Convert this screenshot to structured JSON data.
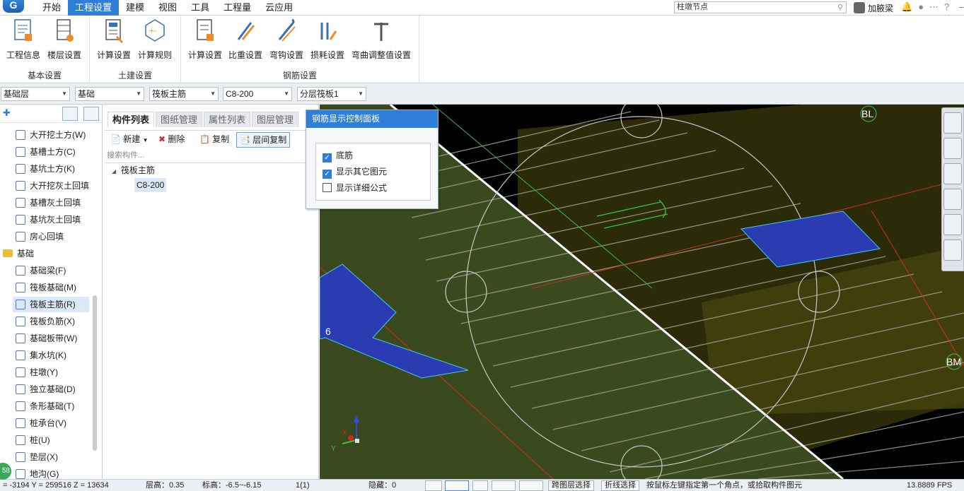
{
  "menu": {
    "tabs": [
      "开始",
      "工程设置",
      "建模",
      "视图",
      "工具",
      "工程量",
      "云应用"
    ],
    "active_tab": "工程设置",
    "search_value": "柱墩节点",
    "user_name": "加腋梁"
  },
  "ribbon": {
    "groups": [
      {
        "title": "基本设置",
        "buttons": [
          "工程信息",
          "楼层设置"
        ]
      },
      {
        "title": "土建设置",
        "buttons": [
          "计算设置",
          "计算规则"
        ]
      },
      {
        "title": "钢筋设置",
        "buttons": [
          "计算设置",
          "比重设置",
          "弯钩设置",
          "损耗设置",
          "弯曲调整值设置"
        ]
      }
    ]
  },
  "selectors": {
    "floor": "基础层",
    "category": "基础",
    "element_type": "筏板主筋",
    "element": "C8-200",
    "layer": "分层筏板1"
  },
  "tree": {
    "items": [
      {
        "label": "大开挖土方(W)"
      },
      {
        "label": "基槽土方(C)"
      },
      {
        "label": "基坑土方(K)"
      },
      {
        "label": "大开挖灰土回填"
      },
      {
        "label": "基槽灰土回填"
      },
      {
        "label": "基坑灰土回填"
      },
      {
        "label": "房心回填"
      },
      {
        "label": "基础"
      },
      {
        "label": "基础梁(F)"
      },
      {
        "label": "筏板基础(M)"
      },
      {
        "label": "筏板主筋(R)"
      },
      {
        "label": "筏板负筋(X)"
      },
      {
        "label": "基础板带(W)"
      },
      {
        "label": "集水坑(K)"
      },
      {
        "label": "柱墩(Y)"
      },
      {
        "label": "独立基础(D)"
      },
      {
        "label": "条形基础(T)"
      },
      {
        "label": "桩承台(V)"
      },
      {
        "label": "桩(U)"
      },
      {
        "label": "垫层(X)"
      },
      {
        "label": "地沟(G)"
      }
    ]
  },
  "component_panel": {
    "tabs": [
      "构件列表",
      "图纸管理",
      "属性列表",
      "图层管理"
    ],
    "toolbar": {
      "new": "新建",
      "delete": "删除",
      "copy": "复制",
      "floor_copy": "层间复制"
    },
    "search_placeholder": "搜索构件...",
    "tree_parent": "筏板主筋",
    "tree_child": "C8-200"
  },
  "control_panel": {
    "title": "钢筋显示控制面板",
    "options": [
      {
        "label": "底筋",
        "checked": true
      },
      {
        "label": "显示其它图元",
        "checked": true
      },
      {
        "label": "显示详细公式",
        "checked": false
      }
    ]
  },
  "viewport": {
    "labels": {
      "bl": "BL",
      "bm": "BM",
      "six": "6"
    },
    "axes": {
      "x": "X",
      "y": "Y",
      "z": "Z"
    }
  },
  "status": {
    "coords": "= -3194 Y = 259516 Z = 13634",
    "floor_height": "层高：0.35",
    "elevation": "标高：-6.5~-6.15",
    "page": "1(1)",
    "hidden": "隐藏：0",
    "cross_floor_select": "跨图层选择",
    "polyline_select": "折线选择",
    "hint": "按鼠标左键指定第一个角点，或拾取构件图元",
    "fps": "13.8889 FPS",
    "fps_circle": "58"
  }
}
